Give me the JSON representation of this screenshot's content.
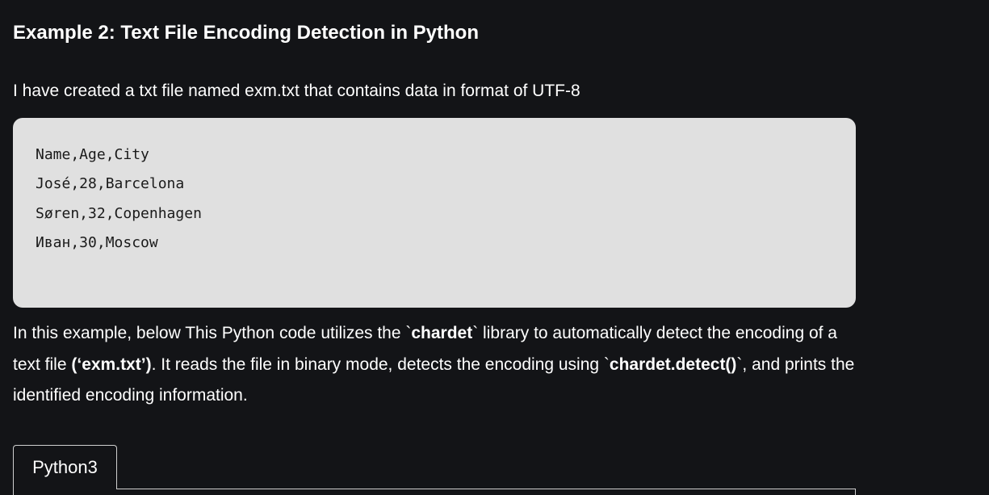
{
  "heading": "Example 2: Text File Encoding Detection in Python",
  "intro": "I have created a txt file named exm.txt that contains data in format of UTF-8",
  "code_lines": [
    "Name,Age,City",
    "José,28,Barcelona",
    "Søren,32,Copenhagen",
    "Иван,30,Moscow"
  ],
  "explanation": {
    "part1": "In this example, below This Python code utilizes the `",
    "bold1": "chardet",
    "part2": "` library to automatically detect the encoding of a text file ",
    "bold2": "(‘exm.txt’)",
    "part3": ". It reads the file in binary mode, detects the encoding using `",
    "bold3": "chardet.detect()",
    "part4": "`, and prints the identified encoding information."
  },
  "tabs": [
    {
      "label": "Python3"
    }
  ]
}
